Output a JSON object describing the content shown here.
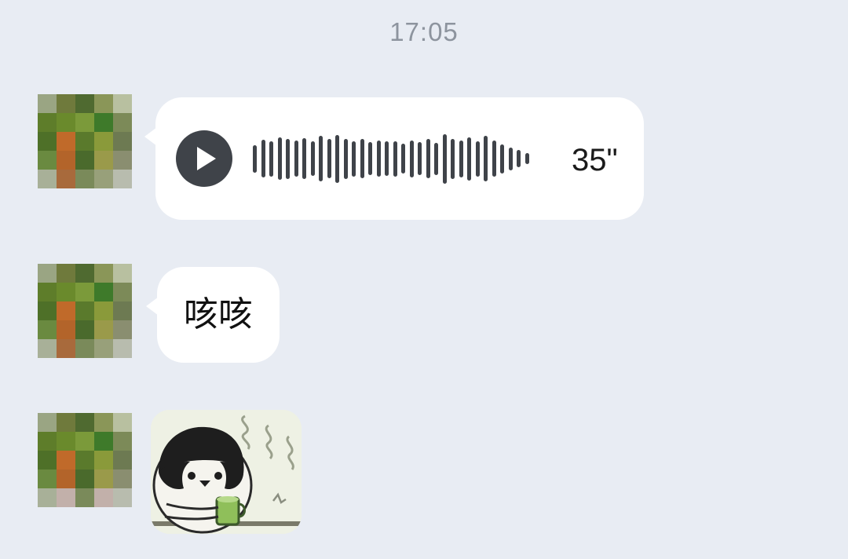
{
  "chat": {
    "timestamp": "17:05",
    "messages": [
      {
        "type": "voice",
        "duration": "35\"",
        "waveform_levels": [
          0.55,
          0.75,
          0.7,
          0.85,
          0.8,
          0.72,
          0.82,
          0.68,
          0.9,
          0.78,
          0.95,
          0.8,
          0.7,
          0.78,
          0.66,
          0.72,
          0.68,
          0.7,
          0.6,
          0.74,
          0.66,
          0.78,
          0.64,
          0.98,
          0.8,
          0.74,
          0.86,
          0.7,
          0.9,
          0.72,
          0.58,
          0.46,
          0.34,
          0.22
        ]
      },
      {
        "type": "text",
        "text": "咳咳"
      },
      {
        "type": "sticker",
        "sticker_name": "penguin-drinking-tea"
      }
    ]
  },
  "icons": {
    "play": "play-icon"
  },
  "colors": {
    "background": "#e8ecf3",
    "bubble": "#ffffff",
    "icon_dark": "#3f4349",
    "timestamp": "#8d949e"
  },
  "avatar_palette": [
    "#9aa583",
    "#6f7a3c",
    "#4f6a30",
    "#8a9658",
    "#b8c0a0",
    "#5e7d2a",
    "#6a8a2c",
    "#7b9a3a",
    "#3e7a2a",
    "#7c8a58",
    "#4e7028",
    "#c06a2a",
    "#5a7a2c",
    "#8a9a3a",
    "#6d7a52",
    "#6a8a40",
    "#b3642a",
    "#4a6a2c",
    "#9a9a4a",
    "#8a8e70",
    "#a8b098",
    "#a86a3c",
    "#7a8a5a",
    "#98a07a",
    "#b8bcae"
  ]
}
